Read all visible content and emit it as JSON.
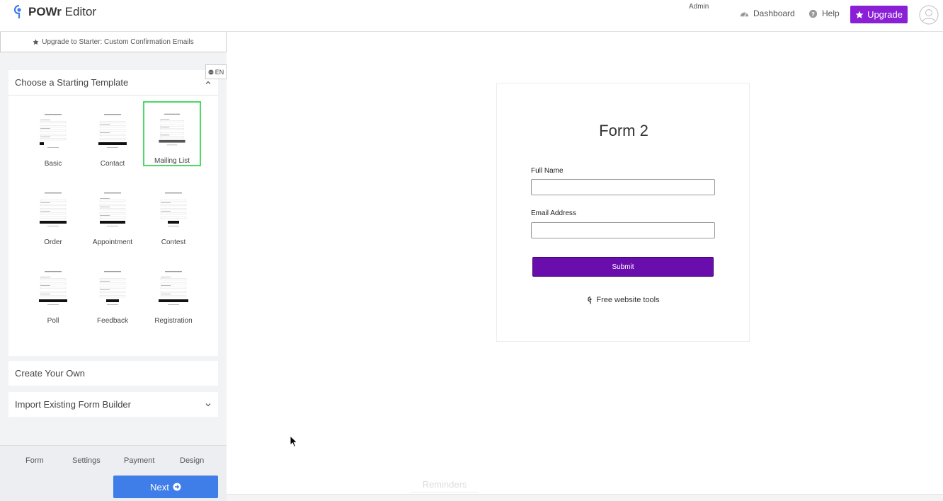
{
  "app": {
    "logo_bold": "POWr",
    "logo_rest": " Editor"
  },
  "header": {
    "admin": "Admin",
    "dashboard": "Dashboard",
    "help": "Help",
    "upgrade": "Upgrade"
  },
  "sidebar": {
    "upgrade_banner": "Upgrade to Starter: Custom Confirmation Emails",
    "language": "EN",
    "templates_title": "Choose a Starting Template",
    "templates": [
      {
        "label": "Basic",
        "selected": false
      },
      {
        "label": "Contact",
        "selected": false
      },
      {
        "label": "Mailing List",
        "selected": true
      },
      {
        "label": "Order",
        "selected": false
      },
      {
        "label": "Appointment",
        "selected": false
      },
      {
        "label": "Contest",
        "selected": false
      },
      {
        "label": "Poll",
        "selected": false
      },
      {
        "label": "Feedback",
        "selected": false
      },
      {
        "label": "Registration",
        "selected": false
      }
    ],
    "create_own": "Create Your Own",
    "import_builder": "Import Existing Form Builder",
    "tabs": [
      "Form",
      "Settings",
      "Payment",
      "Design"
    ],
    "next": "Next"
  },
  "preview": {
    "form_title": "Form 2",
    "fields": [
      {
        "label": "Full Name",
        "value": ""
      },
      {
        "label": "Email Address",
        "value": ""
      }
    ],
    "submit": "Submit",
    "powered": "Free website tools",
    "reminders": "Reminders"
  },
  "colors": {
    "upgrade": "#8a1fd6",
    "next": "#3f7ee8",
    "submit": "#6a0dad",
    "selected_border": "#4cd964"
  }
}
